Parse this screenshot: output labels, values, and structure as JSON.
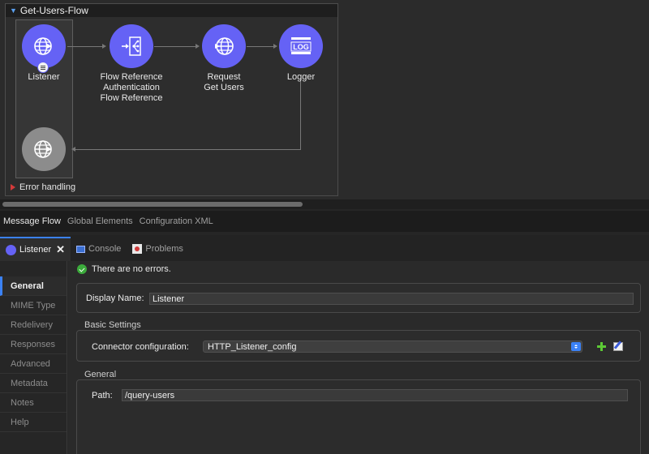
{
  "canvas": {
    "flow_name": "Get-Users-Flow",
    "nodes": [
      {
        "name": "listener",
        "icon": "http-listener-globe-icon",
        "lines": [
          "Listener"
        ]
      },
      {
        "name": "flow-reference",
        "icon": "flow-reference-icon",
        "lines": [
          "Flow Reference",
          "Authentication",
          "Flow Reference"
        ]
      },
      {
        "name": "request",
        "icon": "http-request-globe-icon",
        "lines": [
          "Request",
          "Get Users"
        ]
      },
      {
        "name": "logger",
        "icon": "logger-log-icon",
        "lines": [
          "Logger"
        ]
      }
    ],
    "response_node_icon": "http-response-globe-icon",
    "error_handling": "Error handling",
    "colors": {
      "node": "#6562f5",
      "response_node": "#8c8c8c",
      "error_marker": "#d43a3a"
    }
  },
  "editor_tabs": [
    "Message Flow",
    "Global Elements",
    "Configuration XML"
  ],
  "view_tabs": {
    "listener": "Listener",
    "console": "Console",
    "problems": "Problems"
  },
  "left_nav": [
    "General",
    "MIME Type",
    "Redelivery",
    "Responses",
    "Advanced",
    "Metadata",
    "Notes",
    "Help"
  ],
  "form": {
    "status": "There are no errors.",
    "display_name_label": "Display Name:",
    "display_name_value": "Listener",
    "basic_settings_label": "Basic Settings",
    "connector_label": "Connector configuration:",
    "connector_value": "HTTP_Listener_config",
    "general_label": "General",
    "path_label": "Path:",
    "path_value": "/query-users"
  }
}
